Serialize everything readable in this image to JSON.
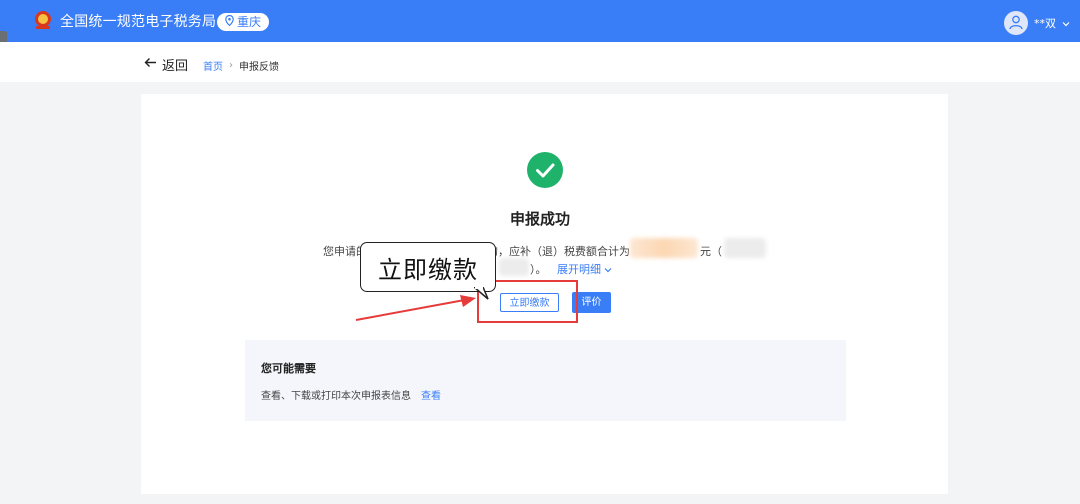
{
  "header": {
    "site_title": "全国统一规范电子税务局",
    "region": "重庆",
    "user_name": "**双"
  },
  "nav": {
    "back_label": "返回",
    "breadcrumb_home": "首页",
    "breadcrumb_current": "申报反馈"
  },
  "result": {
    "title": "申报成功",
    "summary_prefix": "您申请的",
    "summary_mid": "的，应补（退）税费额合计为",
    "yuan": "元（",
    "paren_close": "）。",
    "expand_label": "展开明细",
    "pay_button": "立即缴款",
    "rate_button": "评价"
  },
  "callout": {
    "text": "立即缴款"
  },
  "suggest": {
    "title": "您可能需要",
    "text": "查看、下载或打印本次申报表信息",
    "link": "查看"
  },
  "colors": {
    "primary": "#3a7ef7",
    "success": "#1fb26b",
    "annotation_red": "#e63b3b"
  }
}
